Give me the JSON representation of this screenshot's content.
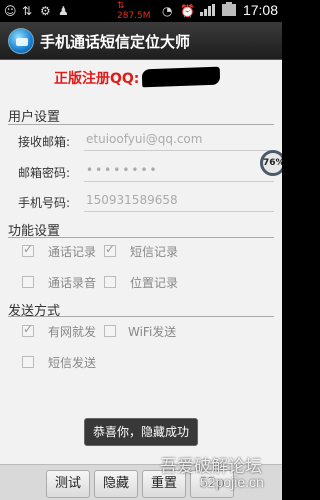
{
  "status_bar": {
    "speed": "287.5M",
    "time": "17:08",
    "icons": [
      "qq-icon",
      "usb-icon",
      "android-debug-icon",
      "android-icon",
      "wifi-icon",
      "alarm-icon",
      "signal-icon",
      "battery-icon"
    ]
  },
  "app": {
    "title": "手机通话短信定位大师"
  },
  "registration": {
    "text": "正版注册QQ:"
  },
  "user_settings": {
    "header": "用户设置",
    "email_label": "接收邮箱:",
    "email_value": "etuioofyui@qq.com",
    "password_label": "邮箱密码:",
    "password_value": "••••••••",
    "phone_label": "手机号码:",
    "phone_value": "150931589658"
  },
  "badge": {
    "value": "76%"
  },
  "function_settings": {
    "header": "功能设置",
    "options": [
      {
        "label": "通话记录",
        "checked": true
      },
      {
        "label": "短信记录",
        "checked": true
      },
      {
        "label": "通话录音",
        "checked": false
      },
      {
        "label": "位置记录",
        "checked": false
      }
    ]
  },
  "send_mode": {
    "header": "发送方式",
    "options": [
      {
        "label": "有网就发",
        "checked": true
      },
      {
        "label": "WiFi发送",
        "checked": false
      },
      {
        "label": "短信发送",
        "checked": false
      }
    ]
  },
  "toast": {
    "text": "恭喜你，隐藏成功"
  },
  "buttons": {
    "test": "测试",
    "hide": "隐藏",
    "reset": "重置"
  },
  "watermark": {
    "line1": "吾爱破解论坛",
    "line2": "52pojie.cn",
    "partial": "52p"
  },
  "colors": {
    "accent_red": "#e21a1a",
    "speed_red": "#e0301e"
  }
}
